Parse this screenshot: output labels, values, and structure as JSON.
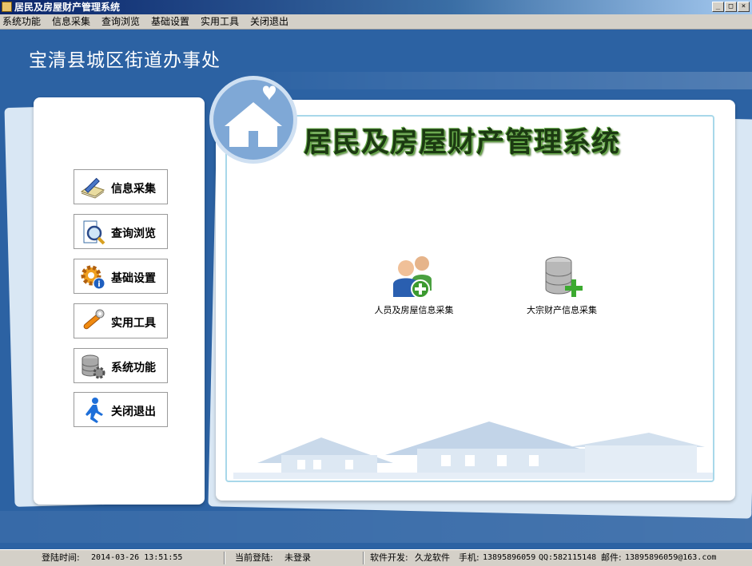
{
  "window": {
    "title": "居民及房屋财产管理系统",
    "controls": [
      "minimize",
      "maximize",
      "close"
    ]
  },
  "menu": [
    "系统功能",
    "信息采集",
    "查询浏览",
    "基础设置",
    "实用工具",
    "关闭退出"
  ],
  "header": {
    "org_name": "宝清县城区街道办事处"
  },
  "sidebar": {
    "buttons": [
      {
        "label": "信息采集",
        "icon": "pen-paper-icon"
      },
      {
        "label": "查询浏览",
        "icon": "magnifier-document-icon"
      },
      {
        "label": "基础设置",
        "icon": "gear-info-icon"
      },
      {
        "label": "实用工具",
        "icon": "wrench-icon"
      },
      {
        "label": "系统功能",
        "icon": "database-gear-icon"
      },
      {
        "label": "关闭退出",
        "icon": "running-man-icon"
      }
    ]
  },
  "main": {
    "system_title": "居民及房屋财产管理系统",
    "features": [
      {
        "label": "人员及房屋信息采集",
        "icon": "users-add-icon"
      },
      {
        "label": "大宗财产信息采集",
        "icon": "database-add-icon"
      }
    ]
  },
  "status": {
    "login_time_label": "登陆时间:",
    "login_time": "2014-03-26 13:51:55",
    "current_user_label": "当前登陆:",
    "current_user": "未登录",
    "dev_label": "软件开发:",
    "dev_name": "久龙软件",
    "phone_label": "手机:",
    "phone": "13895896059",
    "qq_label": "QQ:",
    "qq": "582115148",
    "email_label": "邮件:",
    "email": "13895896059@163.com"
  },
  "colors": {
    "background": "#2c62a3",
    "panel": "#ffffff",
    "accent_green": "#1c3a12",
    "frame": "#a8d8ea"
  }
}
